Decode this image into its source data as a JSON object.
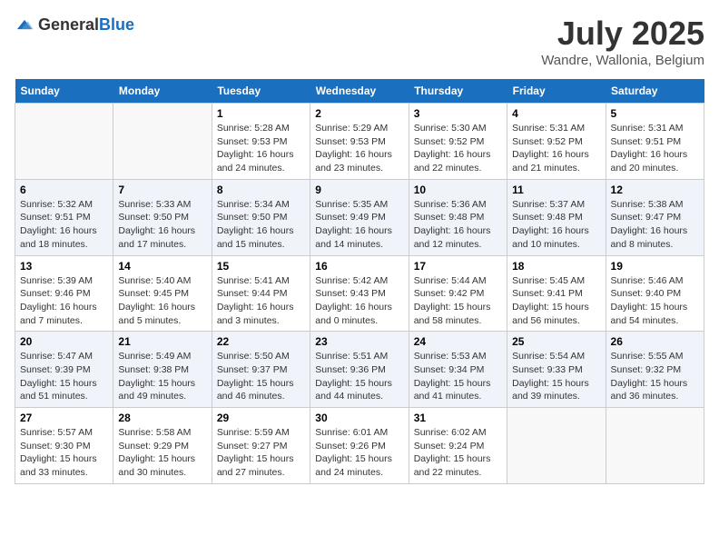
{
  "header": {
    "logo_general": "General",
    "logo_blue": "Blue",
    "month": "July 2025",
    "location": "Wandre, Wallonia, Belgium"
  },
  "days_of_week": [
    "Sunday",
    "Monday",
    "Tuesday",
    "Wednesday",
    "Thursday",
    "Friday",
    "Saturday"
  ],
  "weeks": [
    [
      {
        "day": "",
        "sunrise": "",
        "sunset": "",
        "daylight": ""
      },
      {
        "day": "",
        "sunrise": "",
        "sunset": "",
        "daylight": ""
      },
      {
        "day": "1",
        "sunrise": "Sunrise: 5:28 AM",
        "sunset": "Sunset: 9:53 PM",
        "daylight": "Daylight: 16 hours and 24 minutes."
      },
      {
        "day": "2",
        "sunrise": "Sunrise: 5:29 AM",
        "sunset": "Sunset: 9:53 PM",
        "daylight": "Daylight: 16 hours and 23 minutes."
      },
      {
        "day": "3",
        "sunrise": "Sunrise: 5:30 AM",
        "sunset": "Sunset: 9:52 PM",
        "daylight": "Daylight: 16 hours and 22 minutes."
      },
      {
        "day": "4",
        "sunrise": "Sunrise: 5:31 AM",
        "sunset": "Sunset: 9:52 PM",
        "daylight": "Daylight: 16 hours and 21 minutes."
      },
      {
        "day": "5",
        "sunrise": "Sunrise: 5:31 AM",
        "sunset": "Sunset: 9:51 PM",
        "daylight": "Daylight: 16 hours and 20 minutes."
      }
    ],
    [
      {
        "day": "6",
        "sunrise": "Sunrise: 5:32 AM",
        "sunset": "Sunset: 9:51 PM",
        "daylight": "Daylight: 16 hours and 18 minutes."
      },
      {
        "day": "7",
        "sunrise": "Sunrise: 5:33 AM",
        "sunset": "Sunset: 9:50 PM",
        "daylight": "Daylight: 16 hours and 17 minutes."
      },
      {
        "day": "8",
        "sunrise": "Sunrise: 5:34 AM",
        "sunset": "Sunset: 9:50 PM",
        "daylight": "Daylight: 16 hours and 15 minutes."
      },
      {
        "day": "9",
        "sunrise": "Sunrise: 5:35 AM",
        "sunset": "Sunset: 9:49 PM",
        "daylight": "Daylight: 16 hours and 14 minutes."
      },
      {
        "day": "10",
        "sunrise": "Sunrise: 5:36 AM",
        "sunset": "Sunset: 9:48 PM",
        "daylight": "Daylight: 16 hours and 12 minutes."
      },
      {
        "day": "11",
        "sunrise": "Sunrise: 5:37 AM",
        "sunset": "Sunset: 9:48 PM",
        "daylight": "Daylight: 16 hours and 10 minutes."
      },
      {
        "day": "12",
        "sunrise": "Sunrise: 5:38 AM",
        "sunset": "Sunset: 9:47 PM",
        "daylight": "Daylight: 16 hours and 8 minutes."
      }
    ],
    [
      {
        "day": "13",
        "sunrise": "Sunrise: 5:39 AM",
        "sunset": "Sunset: 9:46 PM",
        "daylight": "Daylight: 16 hours and 7 minutes."
      },
      {
        "day": "14",
        "sunrise": "Sunrise: 5:40 AM",
        "sunset": "Sunset: 9:45 PM",
        "daylight": "Daylight: 16 hours and 5 minutes."
      },
      {
        "day": "15",
        "sunrise": "Sunrise: 5:41 AM",
        "sunset": "Sunset: 9:44 PM",
        "daylight": "Daylight: 16 hours and 3 minutes."
      },
      {
        "day": "16",
        "sunrise": "Sunrise: 5:42 AM",
        "sunset": "Sunset: 9:43 PM",
        "daylight": "Daylight: 16 hours and 0 minutes."
      },
      {
        "day": "17",
        "sunrise": "Sunrise: 5:44 AM",
        "sunset": "Sunset: 9:42 PM",
        "daylight": "Daylight: 15 hours and 58 minutes."
      },
      {
        "day": "18",
        "sunrise": "Sunrise: 5:45 AM",
        "sunset": "Sunset: 9:41 PM",
        "daylight": "Daylight: 15 hours and 56 minutes."
      },
      {
        "day": "19",
        "sunrise": "Sunrise: 5:46 AM",
        "sunset": "Sunset: 9:40 PM",
        "daylight": "Daylight: 15 hours and 54 minutes."
      }
    ],
    [
      {
        "day": "20",
        "sunrise": "Sunrise: 5:47 AM",
        "sunset": "Sunset: 9:39 PM",
        "daylight": "Daylight: 15 hours and 51 minutes."
      },
      {
        "day": "21",
        "sunrise": "Sunrise: 5:49 AM",
        "sunset": "Sunset: 9:38 PM",
        "daylight": "Daylight: 15 hours and 49 minutes."
      },
      {
        "day": "22",
        "sunrise": "Sunrise: 5:50 AM",
        "sunset": "Sunset: 9:37 PM",
        "daylight": "Daylight: 15 hours and 46 minutes."
      },
      {
        "day": "23",
        "sunrise": "Sunrise: 5:51 AM",
        "sunset": "Sunset: 9:36 PM",
        "daylight": "Daylight: 15 hours and 44 minutes."
      },
      {
        "day": "24",
        "sunrise": "Sunrise: 5:53 AM",
        "sunset": "Sunset: 9:34 PM",
        "daylight": "Daylight: 15 hours and 41 minutes."
      },
      {
        "day": "25",
        "sunrise": "Sunrise: 5:54 AM",
        "sunset": "Sunset: 9:33 PM",
        "daylight": "Daylight: 15 hours and 39 minutes."
      },
      {
        "day": "26",
        "sunrise": "Sunrise: 5:55 AM",
        "sunset": "Sunset: 9:32 PM",
        "daylight": "Daylight: 15 hours and 36 minutes."
      }
    ],
    [
      {
        "day": "27",
        "sunrise": "Sunrise: 5:57 AM",
        "sunset": "Sunset: 9:30 PM",
        "daylight": "Daylight: 15 hours and 33 minutes."
      },
      {
        "day": "28",
        "sunrise": "Sunrise: 5:58 AM",
        "sunset": "Sunset: 9:29 PM",
        "daylight": "Daylight: 15 hours and 30 minutes."
      },
      {
        "day": "29",
        "sunrise": "Sunrise: 5:59 AM",
        "sunset": "Sunset: 9:27 PM",
        "daylight": "Daylight: 15 hours and 27 minutes."
      },
      {
        "day": "30",
        "sunrise": "Sunrise: 6:01 AM",
        "sunset": "Sunset: 9:26 PM",
        "daylight": "Daylight: 15 hours and 24 minutes."
      },
      {
        "day": "31",
        "sunrise": "Sunrise: 6:02 AM",
        "sunset": "Sunset: 9:24 PM",
        "daylight": "Daylight: 15 hours and 22 minutes."
      },
      {
        "day": "",
        "sunrise": "",
        "sunset": "",
        "daylight": ""
      },
      {
        "day": "",
        "sunrise": "",
        "sunset": "",
        "daylight": ""
      }
    ]
  ]
}
